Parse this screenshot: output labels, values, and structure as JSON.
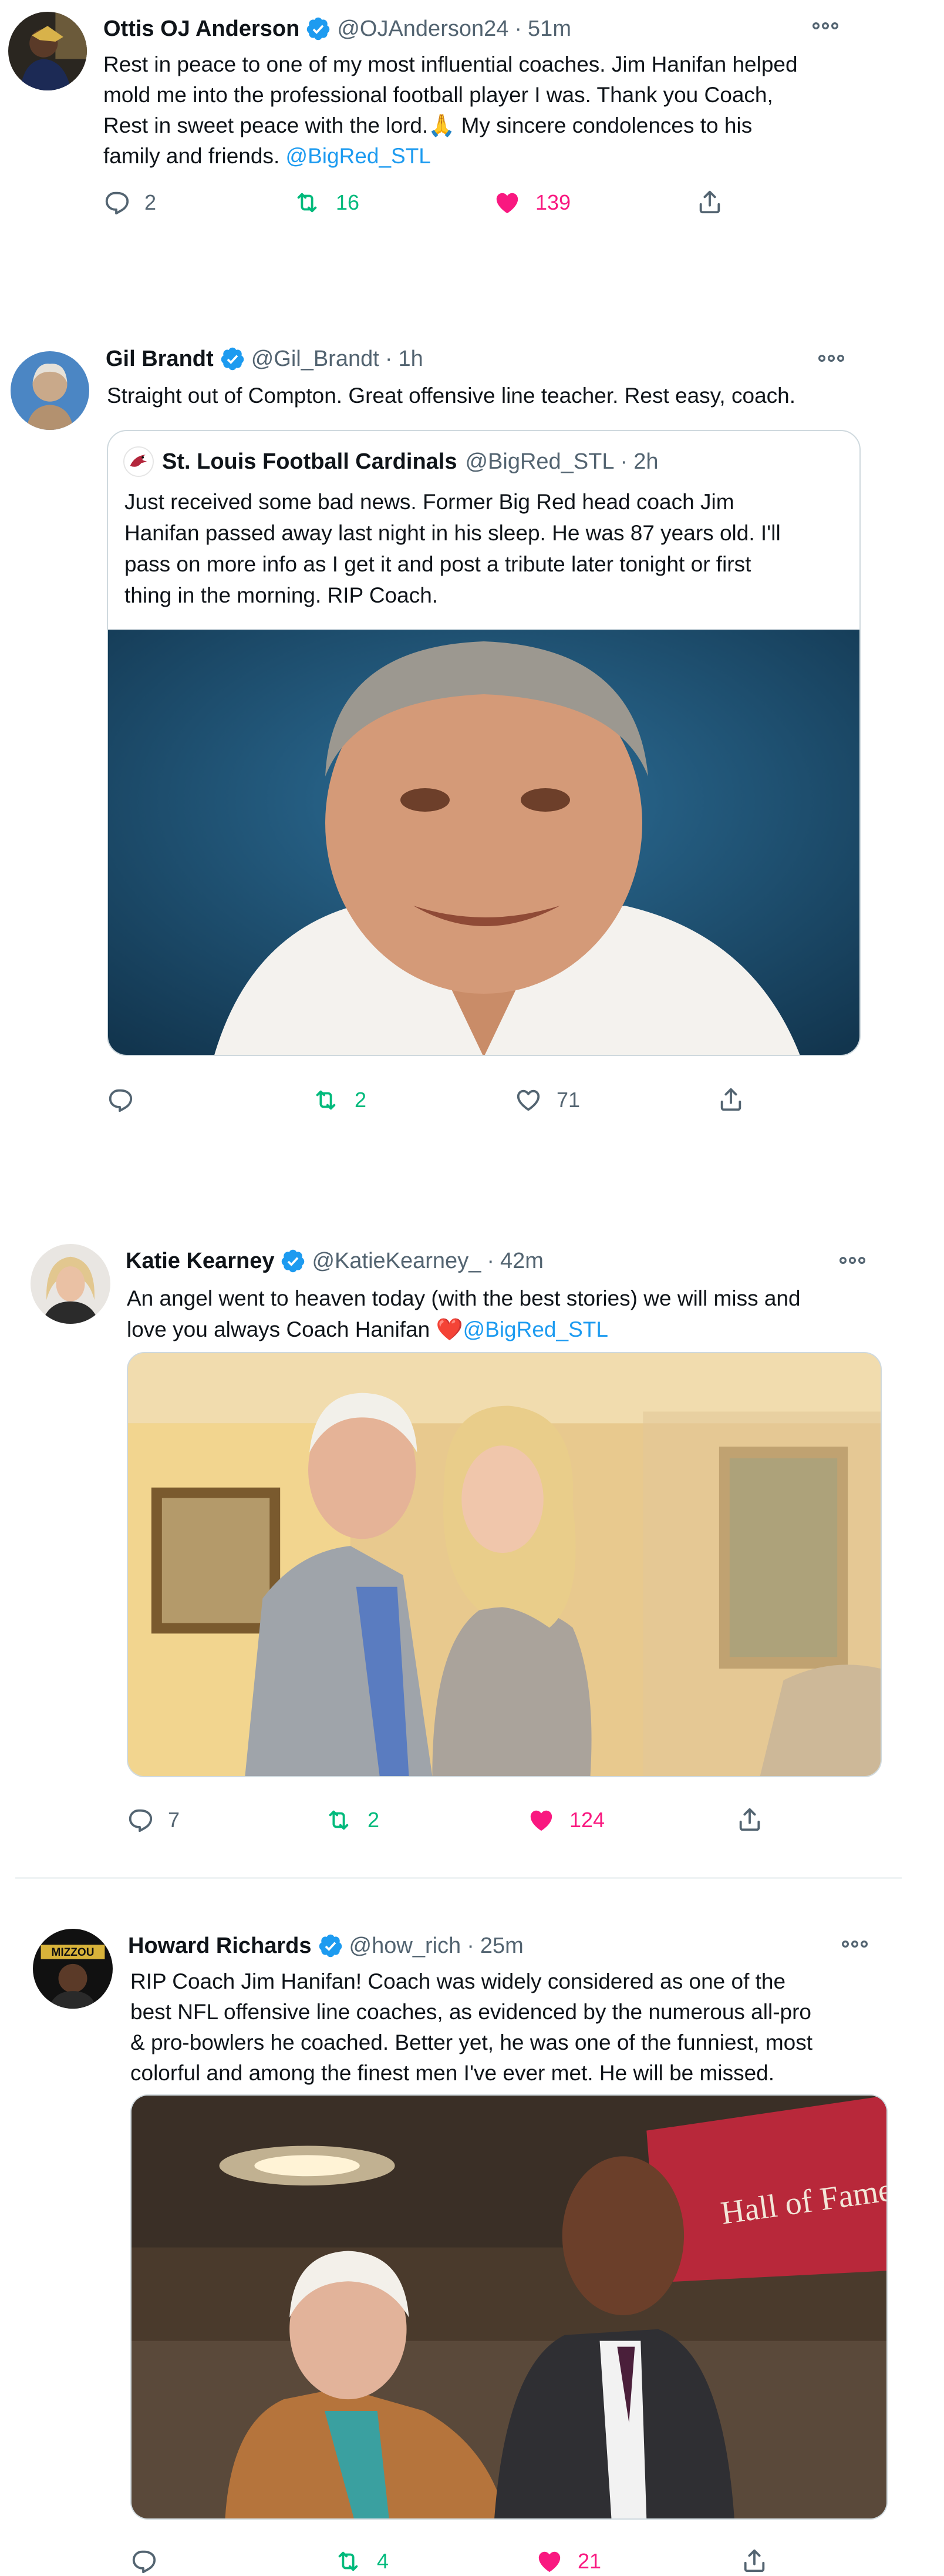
{
  "tweets": [
    {
      "name": "Ottis OJ Anderson",
      "handle": "@OJAnderson24",
      "separator": "·",
      "time": "51m",
      "text_lines": [
        "Rest in peace to one of my most influential coaches. Jim Hanifan helped",
        "mold me into the professional football player I was. Thank you Coach,",
        "Rest in sweet peace with the lord.🙏 My sincere condolences to his",
        "family and friends. "
      ],
      "mention": "@BigRed_STL",
      "replies": "2",
      "retweets": "16",
      "likes": "139",
      "liked": true
    },
    {
      "name": "Gil Brandt",
      "handle": "@Gil_Brandt",
      "separator": "·",
      "time": "1h",
      "text_lines": [
        "Straight out of Compton. Great offensive line teacher. Rest easy, coach."
      ],
      "quote": {
        "name": "St. Louis Football Cardinals",
        "handle": "@BigRed_STL",
        "separator": "·",
        "time": "2h",
        "text_lines": [
          "Just received some bad news. Former Big Red head coach Jim",
          "Hanifan passed away last night in his sleep. He was 87 years old. I'll",
          "pass on more info as I get it and post a tribute later tonight or first",
          "thing in the morning. RIP Coach."
        ]
      },
      "replies": "",
      "retweets": "2",
      "likes": "71",
      "liked": false
    },
    {
      "name": "Katie Kearney",
      "handle": "@KatieKearney_",
      "separator": "·",
      "time": "42m",
      "text_lines": [
        "An angel went to heaven today (with the best stories) we will miss and",
        "love you always Coach Hanifan "
      ],
      "heart_emoji": "❤️",
      "mention": "@BigRed_STL",
      "replies": "7",
      "retweets": "2",
      "likes": "124",
      "liked": true
    },
    {
      "name": "Howard Richards",
      "handle": "@how_rich",
      "separator": "·",
      "time": "25m",
      "text_lines": [
        "RIP Coach Jim Hanifan!  Coach was widely considered as one of the",
        "best NFL offensive line coaches, as evidenced by the numerous all-pro",
        "& pro-bowlers he coached.  Better yet, he was one of the funniest, most",
        "colorful and among the finest men I've ever met. He will be missed."
      ],
      "banner_text": "Hall of Fame",
      "replies": "",
      "retweets": "4",
      "likes": "21",
      "liked": true
    }
  ],
  "colors": {
    "verified": "#1d9bf0",
    "retweet": "#00ba7c",
    "like": "#f91880",
    "muted": "#536471",
    "link": "#1d9bf0"
  },
  "icons": [
    "reply-icon",
    "retweet-icon",
    "like-icon",
    "share-icon",
    "more-icon",
    "verified-icon"
  ]
}
